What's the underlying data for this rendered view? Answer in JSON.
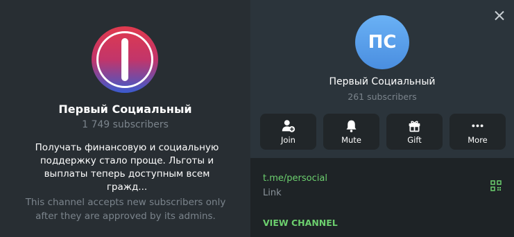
{
  "channel_preview": {
    "title": "Первый Социальный",
    "subscribers": "1 749 subscribers",
    "description": "Получать финансовую и социальную поддержку стало проще. Льготы и выплаты теперь доступным всем гражд...",
    "note": "This channel accepts new subscribers only after they are approved by its admins."
  },
  "profile": {
    "avatar_initials": "ПС",
    "title": "Первый Социальный",
    "subscribers": "261 subscribers"
  },
  "actions": [
    {
      "label": "Join",
      "icon": "add-user-icon"
    },
    {
      "label": "Mute",
      "icon": "bell-icon"
    },
    {
      "label": "Gift",
      "icon": "gift-icon"
    },
    {
      "label": "More",
      "icon": "more-dots-icon"
    }
  ],
  "link": {
    "url": "t.me/persocial",
    "label": "Link"
  },
  "view_channel_label": "VIEW CHANNEL",
  "colors": {
    "accent_green": "#6ccf6e",
    "avatar_blue": "#5aa2ec",
    "panel_bg": "#2b343b"
  }
}
